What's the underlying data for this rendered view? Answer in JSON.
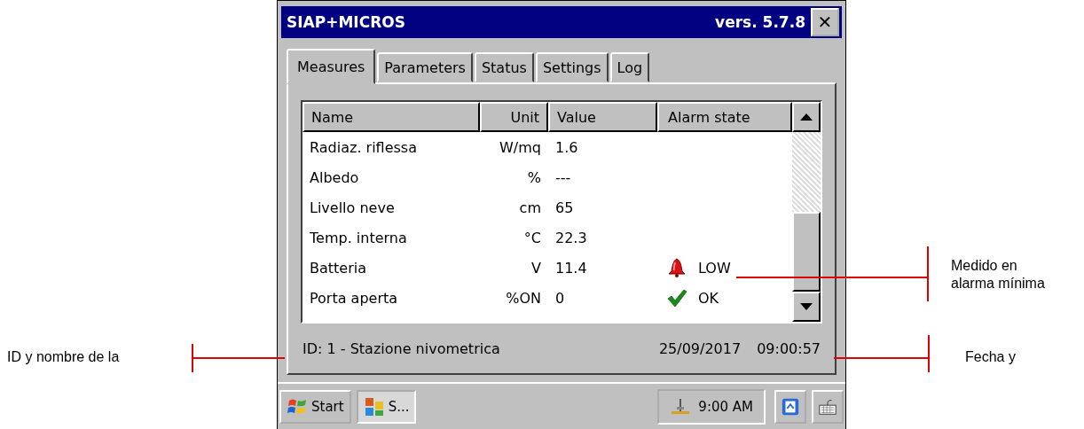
{
  "window": {
    "title": "SIAP+MICROS",
    "version": "vers. 5.7.8",
    "close": "✕"
  },
  "tabs": [
    {
      "label": "Measures",
      "selected": true
    },
    {
      "label": "Parameters",
      "selected": false
    },
    {
      "label": "Status",
      "selected": false
    },
    {
      "label": "Settings",
      "selected": false
    },
    {
      "label": "Log",
      "selected": false
    }
  ],
  "table": {
    "columns": [
      "Name",
      "Unit",
      "Value",
      "Alarm state"
    ],
    "rows": [
      {
        "name": "Radiaz. riflessa",
        "unit": "W/mq",
        "value": "1.6"
      },
      {
        "name": "Albedo",
        "unit": "%",
        "value": "---"
      },
      {
        "name": "Livello neve",
        "unit": "cm",
        "value": "65"
      },
      {
        "name": "Temp. interna",
        "unit": "°C",
        "value": "22.3"
      },
      {
        "name": "Batteria",
        "unit": "V",
        "value": "11.4",
        "alarm": {
          "kind": "low",
          "label": "LOW"
        }
      },
      {
        "name": "Porta aperta",
        "unit": "%ON",
        "value": "0",
        "alarm": {
          "kind": "ok",
          "label": "OK"
        }
      }
    ]
  },
  "status_bar": {
    "station": "ID: 1 - Stazione nivometrica",
    "date": "25/09/2017",
    "time": "09:00:57"
  },
  "taskbar": {
    "start": "Start",
    "app": "S...",
    "clock": "9:00 AM"
  },
  "annotations": [
    {
      "kind": "right",
      "text": "Medido en alarma mínima"
    },
    {
      "kind": "left",
      "text": "ID y nombre de la"
    },
    {
      "kind": "right-bottom",
      "text": "Fecha y"
    }
  ]
}
